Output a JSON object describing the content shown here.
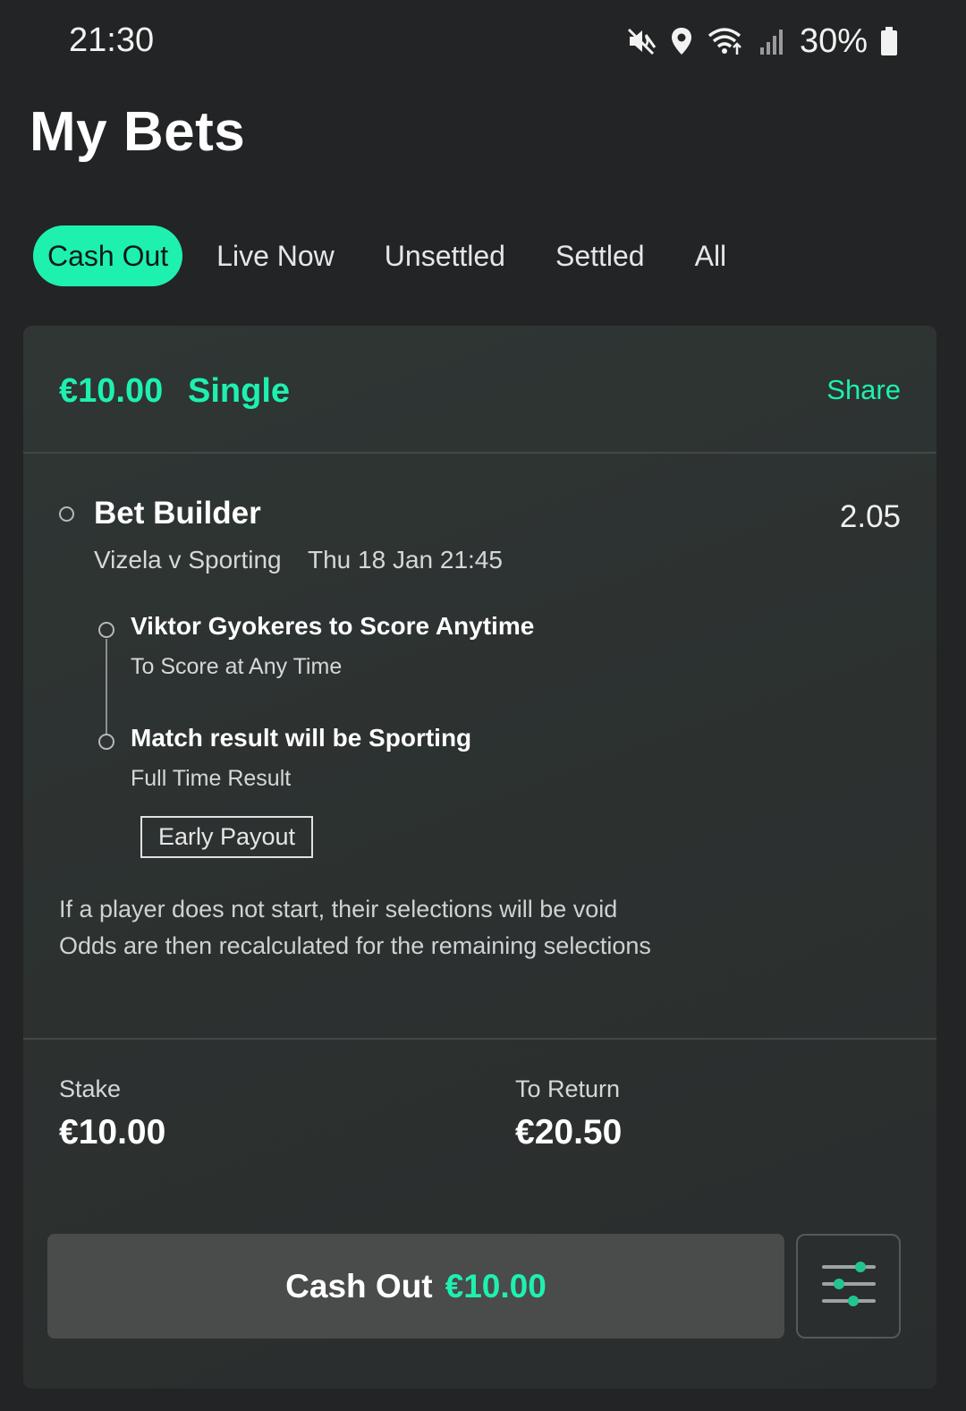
{
  "status_bar": {
    "time": "21:30",
    "battery": "30%",
    "icons": [
      "mute-icon",
      "location-icon",
      "wifi-icon",
      "signal-icon",
      "battery-icon"
    ]
  },
  "title": "My Bets",
  "tabs": [
    {
      "label": "Cash Out",
      "active": true
    },
    {
      "label": "Live Now",
      "active": false
    },
    {
      "label": "Unsettled",
      "active": false
    },
    {
      "label": "Settled",
      "active": false
    },
    {
      "label": "All",
      "active": false
    }
  ],
  "bet": {
    "amount": "€10.00",
    "type": "Single",
    "share_label": "Share",
    "selection": {
      "title": "Bet Builder",
      "odds": "2.05",
      "event": "Vizela v Sporting",
      "date": "Thu 18 Jan 21:45"
    },
    "legs": [
      {
        "title": "Viktor Gyokeres to Score Anytime",
        "market": "To Score at Any Time"
      },
      {
        "title": "Match result will be Sporting",
        "market": "Full Time Result"
      }
    ],
    "badge": "Early Payout",
    "info": [
      "If a player does not start, their selections will be void",
      "Odds are then recalculated for the remaining selections"
    ],
    "stake_label": "Stake",
    "stake_value": "€10.00",
    "return_label": "To Return",
    "return_value": "€20.50",
    "cashout": {
      "label": "Cash Out",
      "amount": "€10.00"
    }
  },
  "colors": {
    "accent": "#1ef0b0",
    "background": "#232425",
    "card": "#2e3433",
    "button": "#4a4b4b"
  }
}
